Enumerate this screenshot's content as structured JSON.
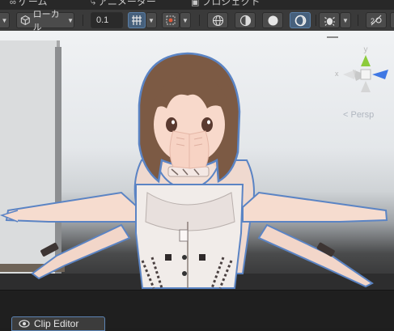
{
  "tabs": [
    {
      "icon": "∞",
      "label": "ゲーム"
    },
    {
      "icon": "⤷",
      "label": "アニメーター"
    },
    {
      "icon": "▣",
      "label": "プロジェクト"
    }
  ],
  "toolbar": {
    "pivot_label": "ローカル",
    "snap_value": "0.1"
  },
  "gizmo": {
    "axis_x": "x",
    "axis_y": "y",
    "projection_label": "< Persp"
  },
  "bottom_panel": {
    "tab_label": "Clip Editor"
  },
  "colors": {
    "toolbar_bg": "#3a3a3a",
    "active_button": "#46607c",
    "outline_blue": "#5b84c4",
    "gizmo_green": "#8ccb3c",
    "gizmo_blue": "#3f78e4"
  }
}
